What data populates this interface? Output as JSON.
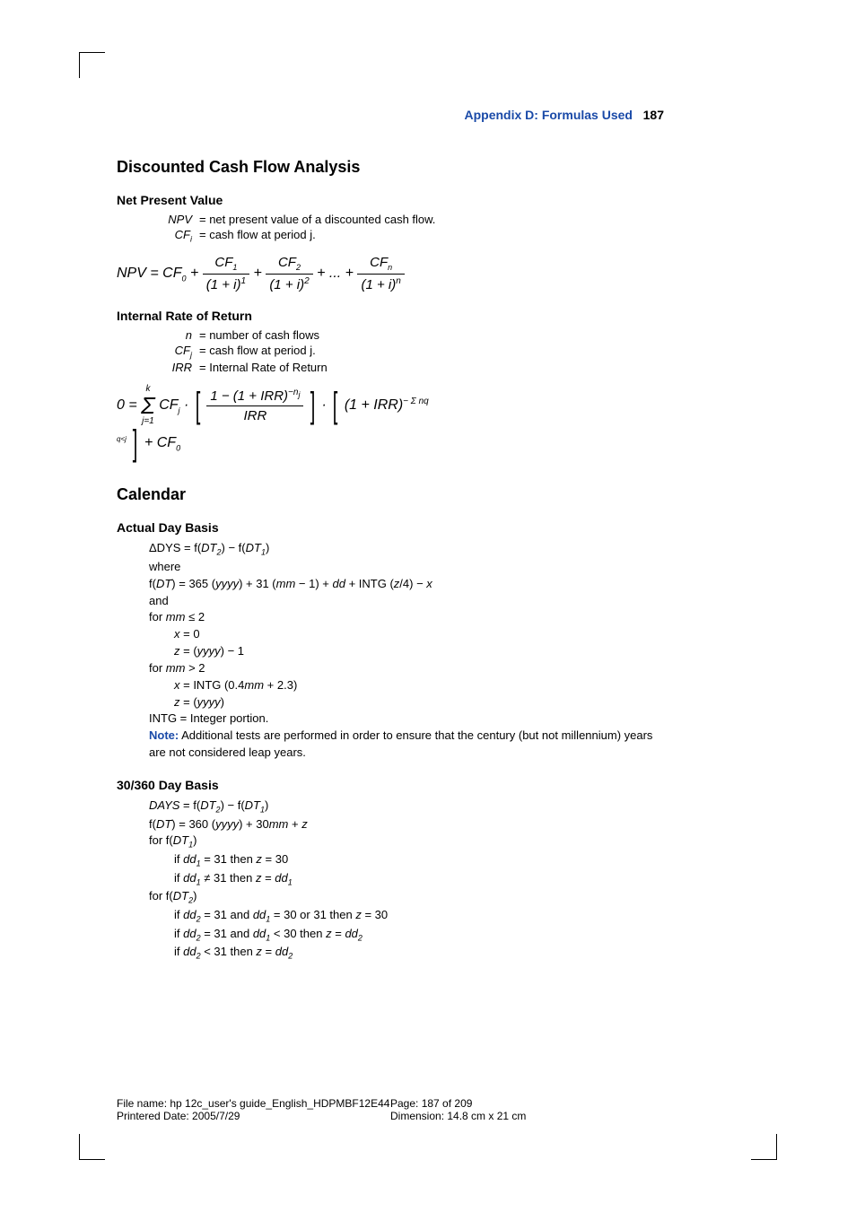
{
  "header": {
    "appendix": "Appendix D: Formulas Used",
    "page_num": "187"
  },
  "section1": {
    "title": "Discounted Cash Flow Analysis",
    "npv": {
      "heading": "Net Present Value",
      "def_npv_sym": "NPV",
      "def_npv": "= net present value of a discounted cash flow.",
      "def_cf_sym": "CF",
      "def_cf_sub": "i",
      "def_cf": "= cash flow at period j.",
      "formula_lhs": "NPV = CF",
      "zero": "0",
      "plus": " + ",
      "cf": "CF",
      "one": "1",
      "two": "2",
      "n": "n",
      "dots": "+ ... +",
      "denom_base": "(1 + i)"
    },
    "irr": {
      "heading": "Internal Rate of Return",
      "def_n_sym": "n",
      "def_n": "= number of cash flows",
      "def_cf_sym": "CF",
      "def_cf_sub": "j",
      "def_cf": "= cash flow at period j.",
      "def_irr_sym": "IRR",
      "def_irr": "= Internal Rate of Return",
      "lhs": "0 =",
      "sum_top": "k",
      "sum_bot": "j=1",
      "cfj": "CF",
      "j": "j",
      "dot": " · ",
      "frac_num_a": "1 − (1 + IRR)",
      "frac_num_exp": "−n",
      "frac_num_exp_sub": "j",
      "frac_den": "IRR",
      "second_base": "(1 + IRR)",
      "second_exp": "− Σ nq",
      "second_exp_sub": "q<j",
      "tail": " + CF",
      "zero": "0"
    }
  },
  "section2": {
    "title": "Calendar",
    "actual": {
      "heading": "Actual Day Basis",
      "l1a": "ΔDYS = f(",
      "l1b": "DT",
      "l1b_sub": "2",
      "l1c": ") − f(",
      "l1d_sub": "1",
      "l1e": ")",
      "l2": "where",
      "l3a": "f(",
      "l3b": "DT",
      "l3c": ") = 365 (",
      "l3d": "yyyy",
      "l3e": ") + 31 (",
      "l3f": "mm",
      "l3g": " − 1) + ",
      "l3h": "dd",
      "l3i": " + INTG (",
      "l3j": "z",
      "l3k": "/4) − ",
      "l3l": "x",
      "l4": "and",
      "l5a": "for ",
      "l5b": "mm",
      "l5c": " ≤ 2",
      "l6a": "x",
      "l6b": " = 0",
      "l7a": "z",
      "l7b": " = (",
      "l7c": "yyyy",
      "l7d": ") − 1",
      "l8a": "for ",
      "l8b": "mm",
      "l8c": " > 2",
      "l9a": "x",
      "l9b": " = INTG (0.4",
      "l9c": "mm",
      "l9d": " + 2.3)",
      "l10a": "z",
      "l10b": " = (",
      "l10c": "yyyy",
      "l10d": ")",
      "l11": "INTG = Integer portion.",
      "note_label": "Note:",
      "note": " Additional tests are performed in order to ensure that the century (but not millennium) years are not considered leap years."
    },
    "basis360": {
      "heading": "30/360 Day Basis",
      "l1a": "DAYS",
      "l1b": " = f(",
      "l1c": "DT",
      "l1c_sub2": "2",
      "l1d": ") − f(",
      "l1c_sub1": "1",
      "l1e": ")",
      "l2a": "f(",
      "l2b": "DT",
      "l2c": ") = 360 (",
      "l2d": "yyyy",
      "l2e": ") + 30",
      "l2f": "mm",
      "l2g": " + ",
      "l2h": "z",
      "l3a": "for f(",
      "l3b": "DT",
      "l3b_sub": "1",
      "l3c": ")",
      "l4a": "if ",
      "l4b": "dd",
      "l4b_sub": "1",
      "l4c": " = 31 then ",
      "l4d": "z",
      "l4e": " = 30",
      "l5a": "if ",
      "l5b": "dd",
      "l5b_sub": "1",
      "l5c": " ≠ 31 then ",
      "l5d": "z",
      "l5e": " = ",
      "l5f": "dd",
      "l5f_sub": "1",
      "l6a": "for f(",
      "l6b": "DT",
      "l6b_sub": "2",
      "l6c": ")",
      "l7a": "if ",
      "l7b": "dd",
      "l7b_sub": "2",
      "l7c": " = 31 and ",
      "l7d": "dd",
      "l7d_sub": "1",
      "l7e": " = 30 or 31 then ",
      "l7f": "z",
      "l7g": " = 30",
      "l8a": "if ",
      "l8b": "dd",
      "l8b_sub": "2",
      "l8c": " = 31 and ",
      "l8d": "dd",
      "l8d_sub": "1",
      "l8e": " < 30 then ",
      "l8f": "z",
      "l8g": " = ",
      "l8h": "dd",
      "l8h_sub": "2",
      "l9a": "if ",
      "l9b": "dd",
      "l9b_sub": "2",
      "l9c": " < 31 then ",
      "l9d": "z",
      "l9e": " = ",
      "l9f": "dd",
      "l9f_sub": "2"
    }
  },
  "footer": {
    "file": "File name: hp 12c_user's guide_English_HDPMBF12E44",
    "printed": "Printered Date: 2005/7/29",
    "page": "Page: 187 of 209",
    "dim": "Dimension: 14.8 cm x 21 cm"
  }
}
